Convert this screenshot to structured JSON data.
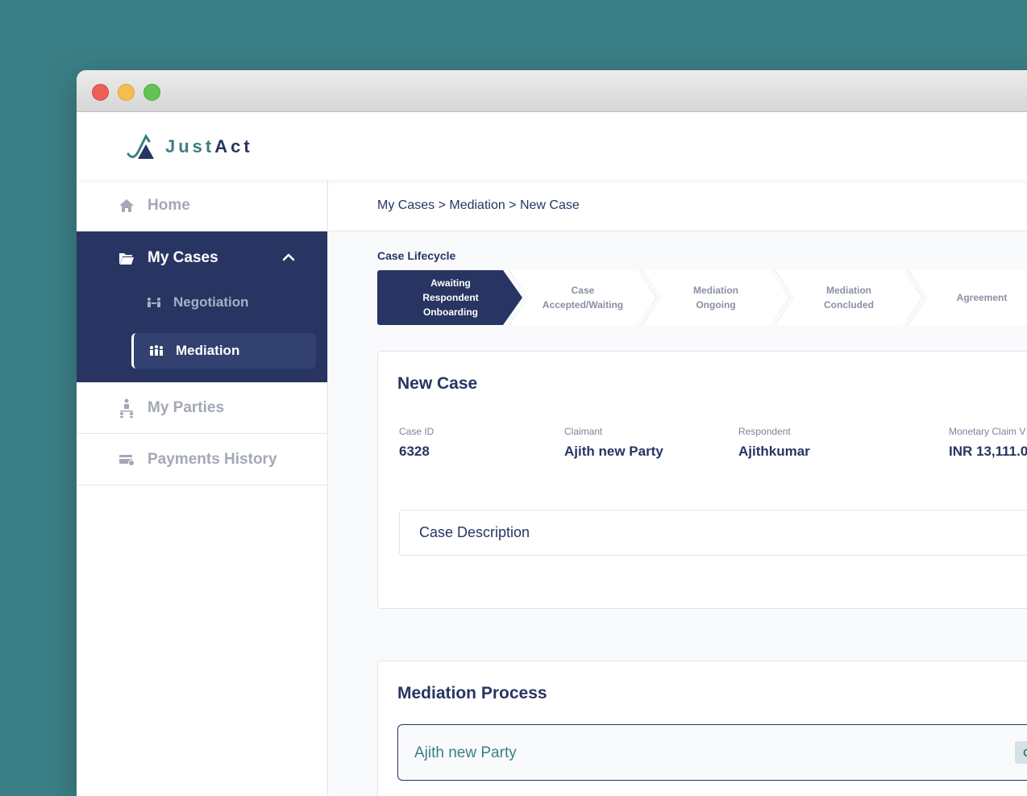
{
  "brand": {
    "part1": "Just",
    "part2": "Act"
  },
  "colors": {
    "primary": "#283562",
    "accent": "#3b7f86",
    "background": "#3b7f86",
    "muted": "#a3a8b6"
  },
  "sidebar": {
    "home": {
      "label": "Home",
      "icon": "home-icon"
    },
    "my_cases": {
      "label": "My Cases",
      "icon": "folder-icon",
      "expanded": true,
      "children": [
        {
          "label": "Negotiation",
          "icon": "negotiation-icon"
        },
        {
          "label": "Mediation",
          "icon": "mediation-icon",
          "active": true
        }
      ]
    },
    "my_parties": {
      "label": "My Parties",
      "icon": "parties-icon"
    },
    "payments": {
      "label": "Payments History",
      "icon": "payment-card-icon"
    }
  },
  "breadcrumb": {
    "text": "My Cases > Mediation > New Case"
  },
  "lifecycle": {
    "label": "Case Lifecycle",
    "steps": [
      {
        "line1": "Awaiting",
        "line2": "Respondent",
        "line3": "Onboarding",
        "active": true
      },
      {
        "line1": "Case",
        "line2": "Accepted/Waiting"
      },
      {
        "line1": "Mediation",
        "line2": "Ongoing"
      },
      {
        "line1": "Mediation",
        "line2": "Concluded"
      },
      {
        "line1": "Agreement"
      }
    ]
  },
  "case": {
    "title": "New Case",
    "fields": [
      {
        "label": "Case ID",
        "value": "6328"
      },
      {
        "label": "Claimant",
        "value": "Ajith new Party"
      },
      {
        "label": "Respondent",
        "value": "Ajithkumar"
      },
      {
        "label": "Monetary Claim V",
        "value": "INR 13,111.0"
      }
    ],
    "description_label": "Case Description"
  },
  "mediation": {
    "title": "Mediation Process",
    "party_name": "Ajith new Party",
    "party_tag": "Oth"
  }
}
